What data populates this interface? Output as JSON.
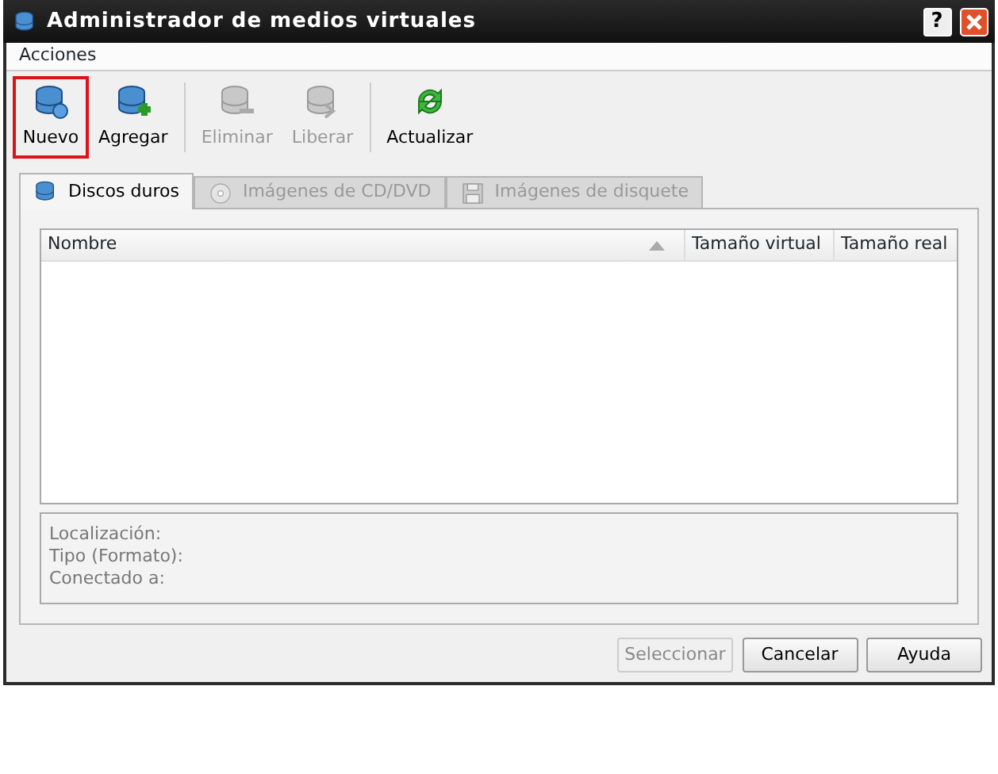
{
  "window": {
    "title": "Administrador de medios virtuales",
    "help": "?"
  },
  "menu": [
    {
      "label": "Acciones"
    }
  ],
  "toolbar": [
    {
      "label": "Nuevo",
      "kind": "new",
      "disabled": false,
      "highlighted": true
    },
    {
      "label": "Agregar",
      "kind": "add",
      "disabled": false,
      "highlighted": false
    },
    {
      "label": "Eliminar",
      "kind": "remove",
      "disabled": true,
      "highlighted": false
    },
    {
      "label": "Liberar",
      "kind": "release",
      "disabled": true,
      "highlighted": false
    },
    {
      "label": "Actualizar",
      "kind": "refresh",
      "disabled": false,
      "highlighted": false
    }
  ],
  "tabs": [
    {
      "label": "Discos duros",
      "kind": "disk",
      "selected": true,
      "disabled": false
    },
    {
      "label": "Imágenes de CD/DVD",
      "kind": "cd",
      "selected": false,
      "disabled": true
    },
    {
      "label": "Imágenes de disquete",
      "kind": "floppy",
      "selected": false,
      "disabled": true
    }
  ],
  "table": {
    "columns": [
      {
        "label": "Nombre",
        "sorted": true
      },
      {
        "label": "Tamaño virtual",
        "sorted": false
      },
      {
        "label": "Tamaño real",
        "sorted": false
      }
    ]
  },
  "details": [
    "Localización:",
    "Tipo (Formato):",
    "Conectado a:"
  ],
  "buttons": [
    {
      "label": "Seleccionar",
      "disabled": true
    },
    {
      "label": "Cancelar",
      "disabled": false
    },
    {
      "label": "Ayuda",
      "disabled": false
    }
  ]
}
